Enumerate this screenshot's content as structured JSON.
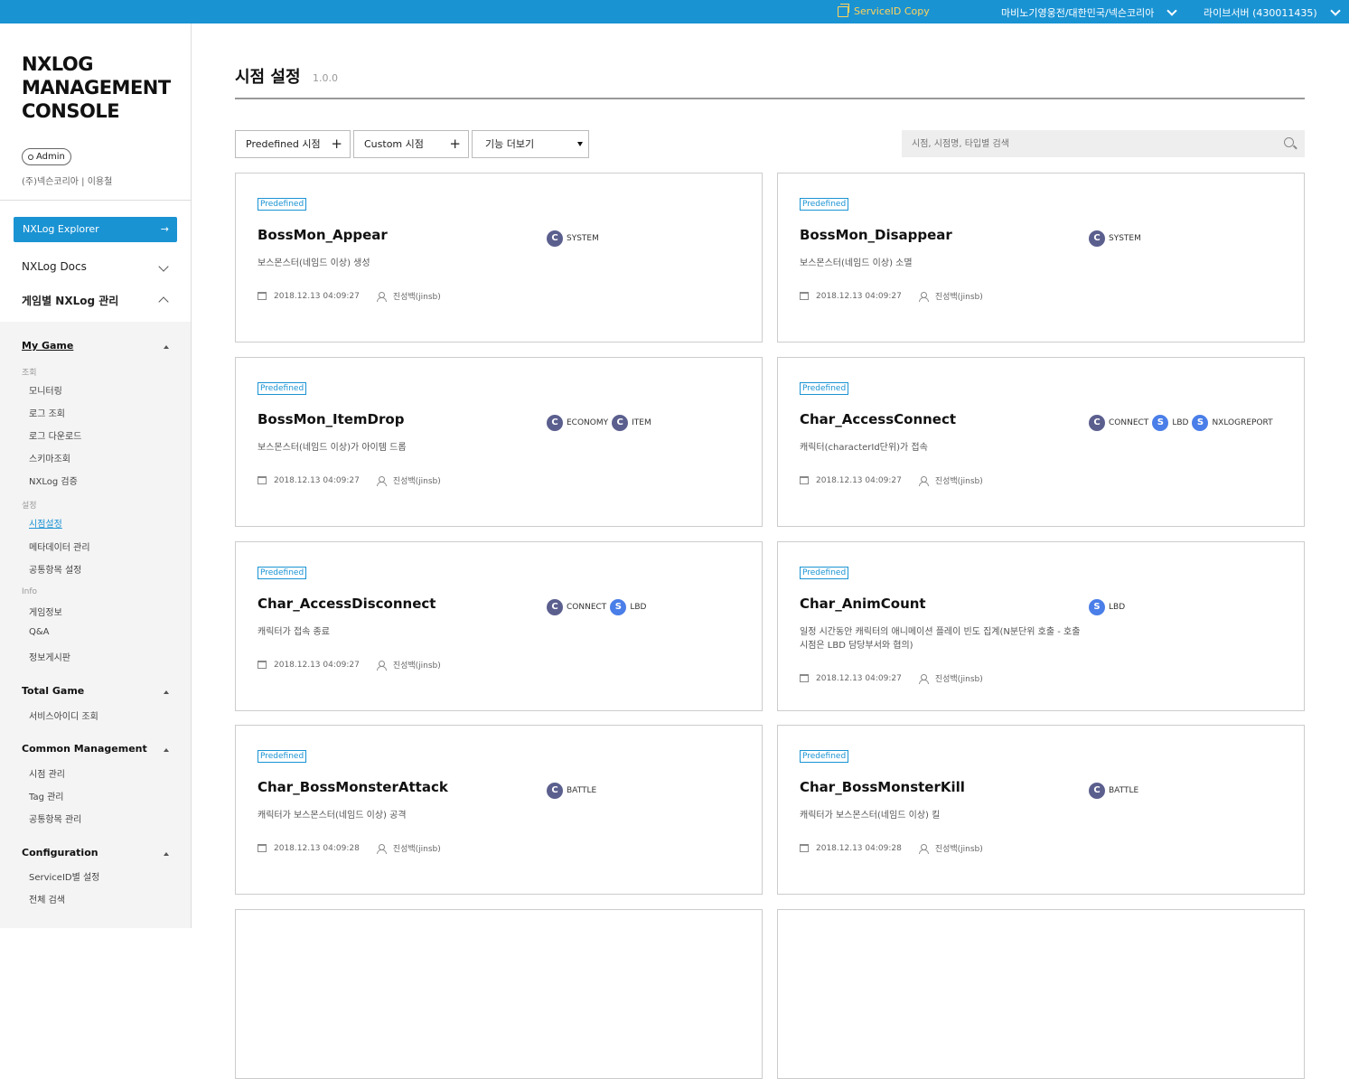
{
  "topbar": {
    "serviceid_copy": "ServiceID Copy",
    "org": "마비노기영웅전/대한민국/넥슨코리아",
    "server": "라이브서버 (430011435)"
  },
  "sidebar": {
    "logo": [
      "NXLOG",
      "MANAGEMENT",
      "CONSOLE"
    ],
    "role": "Admin",
    "user": "(주)넥슨코리아 | 이용철",
    "explorer": "NXLog Explorer",
    "docs": "NXLog Docs",
    "game_mgmt": "게임별 NXLog 관리",
    "sections": {
      "my_game": "My Game",
      "g_view": "조회",
      "monitoring": "모니터링",
      "log_view": "로그 조회",
      "log_download": "로그 다운로드",
      "schema_view": "스키마조회",
      "nxlog_verify": "NXLog 검증",
      "g_settings": "설정",
      "point_settings": "시점설정",
      "metadata": "메타데이터 관리",
      "common_items": "공통항목 설정",
      "g_info": "Info",
      "game_info": "게임정보",
      "qa": "Q&A",
      "board": "정보게시판",
      "total_game": "Total Game",
      "serviceid_view": "서비스아이디 조회",
      "common_mgmt": "Common Management",
      "point_mgmt": "시점 관리",
      "tag_mgmt": "Tag 관리",
      "common_items_mgmt": "공통항목 관리",
      "configuration": "Configuration",
      "serviceid_settings": "ServiceID별 설정",
      "global_search": "전체 검색"
    }
  },
  "main": {
    "title": "시점 설정",
    "version": "1.0.0",
    "btn_predefined": "Predefined 시점",
    "btn_custom": "Custom 시점",
    "btn_more": "기능 더보기",
    "search_placeholder": "시점, 시점명, 타입별 검색"
  },
  "cards": [
    {
      "badge": "Predefined",
      "name": "BossMon_Appear",
      "desc": "보스몬스터(네임드 이상) 생성",
      "date": "2018.12.13 04:09:27",
      "user": "진성백(jinsb)",
      "tags": [
        {
          "t": "C",
          "label": "SYSTEM"
        }
      ]
    },
    {
      "badge": "Predefined",
      "name": "BossMon_Disappear",
      "desc": "보스몬스터(네임드 이상) 소멸",
      "date": "2018.12.13 04:09:27",
      "user": "진성백(jinsb)",
      "tags": [
        {
          "t": "C",
          "label": "SYSTEM"
        }
      ]
    },
    {
      "badge": "Predefined",
      "name": "BossMon_ItemDrop",
      "desc": "보스몬스터(네임드 이상)가 아이템 드롭",
      "date": "2018.12.13 04:09:27",
      "user": "진성백(jinsb)",
      "tags": [
        {
          "t": "C",
          "label": "ECONOMY"
        },
        {
          "t": "C",
          "label": "ITEM"
        }
      ]
    },
    {
      "badge": "Predefined",
      "name": "Char_AccessConnect",
      "desc": "캐릭터(characterId단위)가 접속",
      "date": "2018.12.13 04:09:27",
      "user": "진성백(jinsb)",
      "tags": [
        {
          "t": "C",
          "label": "CONNECT"
        },
        {
          "t": "S",
          "label": "LBD"
        },
        {
          "t": "S",
          "label": "NXLOGREPORT"
        }
      ]
    },
    {
      "badge": "Predefined",
      "name": "Char_AccessDisconnect",
      "desc": "캐릭터가 접속 종료",
      "date": "2018.12.13 04:09:27",
      "user": "진성백(jinsb)",
      "tags": [
        {
          "t": "C",
          "label": "CONNECT"
        },
        {
          "t": "S",
          "label": "LBD"
        }
      ]
    },
    {
      "badge": "Predefined",
      "name": "Char_AnimCount",
      "desc": "일정 시간동안 캐릭터의 애니메이션 플레이 빈도 집계(N분단위 호출 - 호출 시점은 LBD 담당부서와 협의)",
      "date": "2018.12.13 04:09:27",
      "user": "진성백(jinsb)",
      "tags": [
        {
          "t": "S",
          "label": "LBD"
        }
      ]
    },
    {
      "badge": "Predefined",
      "name": "Char_BossMonsterAttack",
      "desc": "캐릭터가 보스몬스터(네임드 이상) 공격",
      "date": "2018.12.13 04:09:28",
      "user": "진성백(jinsb)",
      "tags": [
        {
          "t": "C",
          "label": "BATTLE"
        }
      ]
    },
    {
      "badge": "Predefined",
      "name": "Char_BossMonsterKill",
      "desc": "캐릭터가 보스몬스터(네임드 이상) 킬",
      "date": "2018.12.13 04:09:28",
      "user": "진성백(jinsb)",
      "tags": [
        {
          "t": "C",
          "label": "BATTLE"
        }
      ]
    }
  ]
}
